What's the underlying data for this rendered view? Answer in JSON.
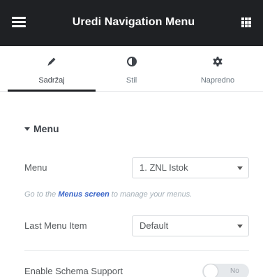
{
  "header": {
    "title": "Uredi Navigation Menu",
    "menu_icon": "hamburger-icon",
    "apps_icon": "grid-icon",
    "bg_color": "#1f2124"
  },
  "tabs": [
    {
      "label": "Sadržaj",
      "icon": "pencil-icon",
      "active": true
    },
    {
      "label": "Stil",
      "icon": "half-circle-icon",
      "active": false
    },
    {
      "label": "Napredno",
      "icon": "gear-icon",
      "active": false
    }
  ],
  "section": {
    "title": "Menu",
    "expanded": true
  },
  "fields": {
    "menu": {
      "label": "Menu",
      "value": "1. ZNL Istok"
    },
    "help": {
      "prefix": "Go to the",
      "link": "Menus screen",
      "suffix": "to manage your menus."
    },
    "last_menu_item": {
      "label": "Last Menu Item",
      "value": "Default"
    },
    "schema": {
      "label": "Enable Schema Support",
      "toggle_text": "No",
      "on": false
    }
  },
  "colors": {
    "link": "#3964c8",
    "text": "#3f444b",
    "muted": "#a4afb7"
  }
}
